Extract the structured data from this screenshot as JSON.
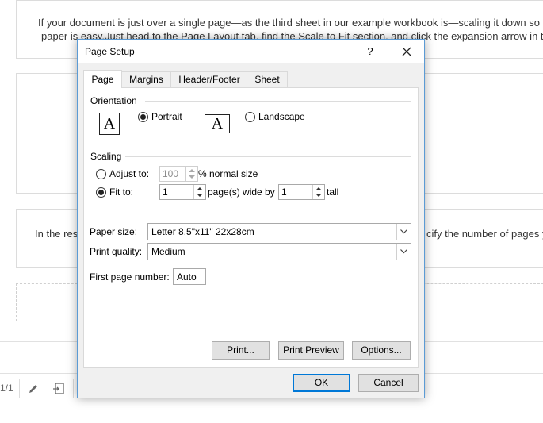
{
  "background": {
    "paragraph1_line1": "If your document is just over a single page—as the third sheet in our example workbook is—scaling it down so",
    "paragraph1_line2": "paper is easy.Just head to the Page Layout tab, find the Scale to Fit section, and click the expansion arrow in th",
    "paragraph2_left": "In the res",
    "paragraph2_right": "cify the number of pages y",
    "page_indicator": "1/1"
  },
  "dialog": {
    "title": "Page Setup",
    "help_label": "?",
    "tabs": [
      "Page",
      "Margins",
      "Header/Footer",
      "Sheet"
    ],
    "active_tab": "Page",
    "orientation": {
      "group_label": "Orientation",
      "portrait_label": "Portrait",
      "landscape_label": "Landscape",
      "icon_glyph": "A",
      "selected": "Portrait"
    },
    "scaling": {
      "group_label": "Scaling",
      "adjust_to_label": "Adjust to:",
      "adjust_value": "100",
      "normal_size_label": "% normal size",
      "fit_to_label": "Fit to:",
      "pages_wide_value": "1",
      "pages_wide_label": "page(s) wide by",
      "pages_tall_value": "1",
      "tall_label": "tall",
      "selected": "Fit to"
    },
    "paper_size": {
      "label": "Paper size:",
      "value": "Letter 8.5\"x11\" 22x28cm"
    },
    "print_quality": {
      "label": "Print quality:",
      "value": "Medium"
    },
    "first_page_number": {
      "label": "First page number:",
      "value": "Auto"
    },
    "buttons": {
      "print": "Print...",
      "print_preview": "Print Preview",
      "options": "Options...",
      "ok": "OK",
      "cancel": "Cancel"
    },
    "accent_color": "#0078d7"
  }
}
